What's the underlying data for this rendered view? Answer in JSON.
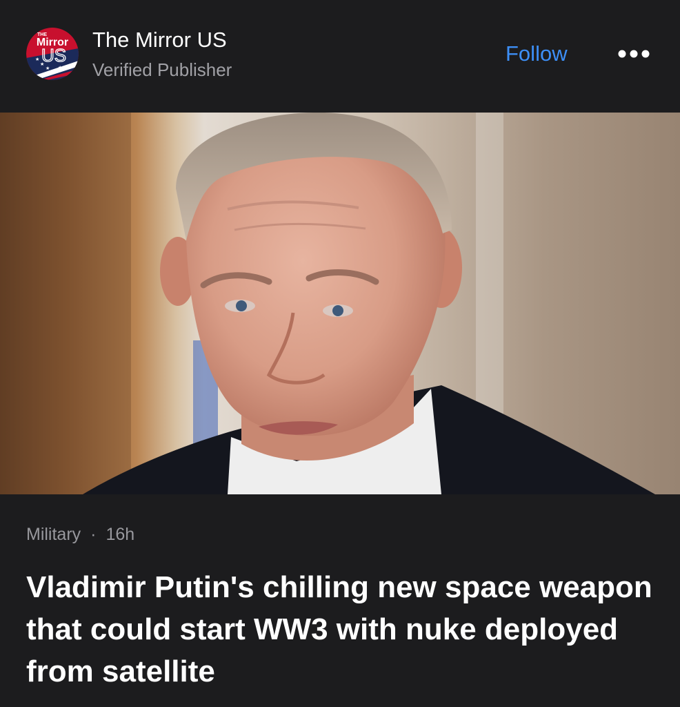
{
  "publisher": {
    "logo_text_small": "THE",
    "logo_text_main": "Mirror",
    "logo_text_sub": "US",
    "name": "The Mirror US",
    "subtitle": "Verified Publisher",
    "follow_label": "Follow",
    "more_icon": "more-horizontal-icon"
  },
  "article": {
    "image_subject": "portrait-photo",
    "category": "Military",
    "separator": "·",
    "time": "16h",
    "headline": "Vladimir Putin's chilling new space weapon that could start WW3 with nuke deployed from satellite"
  },
  "colors": {
    "background": "#1c1c1e",
    "accent": "#3d8ff7",
    "logo_red": "#c8102e",
    "logo_navy": "#1b2a5a"
  }
}
